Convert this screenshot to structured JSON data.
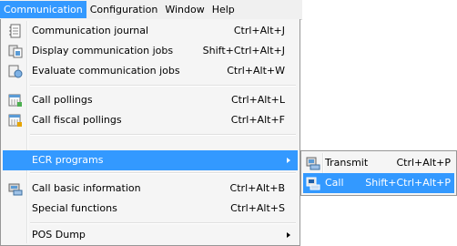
{
  "menubar": {
    "items": [
      "Communication",
      "Configuration",
      "Window",
      "Help"
    ]
  },
  "menu": {
    "items": [
      {
        "label": "Communication journal",
        "shortcut": "Ctrl+Alt+J",
        "icon": "journal-icon"
      },
      {
        "label": "Display communication jobs",
        "shortcut": "Shift+Ctrl+Alt+J",
        "icon": "jobs-display-icon"
      },
      {
        "label": "Evaluate communication jobs",
        "shortcut": "Ctrl+Alt+W",
        "icon": "jobs-evaluate-icon"
      },
      {
        "label": "Call pollings",
        "shortcut": "Ctrl+Alt+L",
        "icon": "pollings-icon"
      },
      {
        "label": "Call fiscal pollings",
        "shortcut": "Ctrl+Alt+F",
        "icon": "fiscal-pollings-icon"
      },
      {
        "label": "ECR programs",
        "shortcut": ""
      },
      {
        "label": "Call basic information",
        "shortcut": "Ctrl+Alt+B",
        "icon": "basic-info-icon"
      },
      {
        "label": "Special functions",
        "shortcut": "Ctrl+Alt+S"
      },
      {
        "label": "POS Dump",
        "shortcut": ""
      }
    ]
  },
  "submenu": {
    "items": [
      {
        "label": "Transmit",
        "shortcut": "Ctrl+Alt+P",
        "icon": "transmit-icon"
      },
      {
        "label": "Call",
        "shortcut": "Shift+Ctrl+Alt+P",
        "icon": "call-icon"
      }
    ]
  },
  "colors": {
    "highlight": "#3399ff",
    "menu_background": "#f5f5f5",
    "menubar_background": "#f0f0f0"
  }
}
